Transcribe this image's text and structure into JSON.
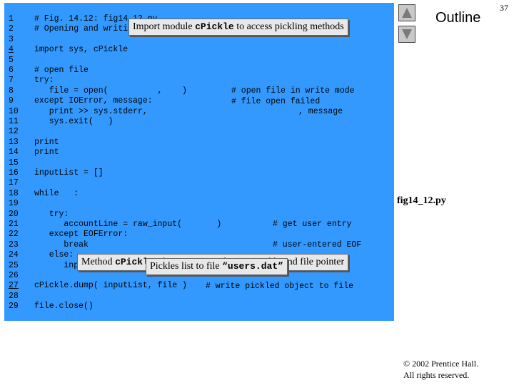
{
  "header": {
    "outline": "Outline",
    "page_number": "37"
  },
  "nav": {
    "up_icon": "triangle-up-icon",
    "down_icon": "triangle-down-icon"
  },
  "code": [
    {
      "n": "1",
      "t": "# Fig. 14.12: fig14_12.py"
    },
    {
      "n": "2",
      "t": "# Opening and writing pickled object to file."
    },
    {
      "n": "3",
      "t": ""
    },
    {
      "n": "4",
      "t": "import sys, cPickle"
    },
    {
      "n": "5",
      "t": ""
    },
    {
      "n": "6",
      "t": "# open file"
    },
    {
      "n": "7",
      "t": "try:"
    },
    {
      "n": "8",
      "t": "   file = open(          ,    )"
    },
    {
      "n": "9",
      "t": "except IOError, message:"
    },
    {
      "n": "10",
      "t": "   print >> sys.stderr,"
    },
    {
      "n": "11",
      "t": "   sys.exit(   )"
    },
    {
      "n": "12",
      "t": ""
    },
    {
      "n": "13",
      "t": "print"
    },
    {
      "n": "14",
      "t": "print"
    },
    {
      "n": "15",
      "t": ""
    },
    {
      "n": "16",
      "t": "inputList = []"
    },
    {
      "n": "17",
      "t": ""
    },
    {
      "n": "18",
      "t": "while   :"
    },
    {
      "n": "19",
      "t": ""
    },
    {
      "n": "20",
      "t": "   try:"
    },
    {
      "n": "21",
      "t": "      accountLine = raw_input(       )"
    },
    {
      "n": "22",
      "t": "   except EOFError:"
    },
    {
      "n": "23",
      "t": "      break"
    },
    {
      "n": "24",
      "t": "   else:"
    },
    {
      "n": "25",
      "t": "      inputList.append( accountLine.split() )"
    },
    {
      "n": "26",
      "t": ""
    },
    {
      "n": "27",
      "t": "cPickle.dump( inputList, file )"
    },
    {
      "n": "28",
      "t": ""
    },
    {
      "n": "29",
      "t": "file.close()"
    }
  ],
  "comments": {
    "line8": "# open file in write mode",
    "line9": "# file open failed",
    "line10": ", message",
    "line21": "# get user entry",
    "line23": "# user-entered EOF",
    "line27": "# write pickled object to file"
  },
  "callouts": {
    "import": {
      "pre": "Import module ",
      "code": "cPickle",
      "post": " to access pickling methods"
    },
    "dump": {
      "pre": "Method ",
      "code": "cPickle.dump",
      "post": " requires object to pickle and file pointer"
    },
    "pickles": {
      "pre": "Pickles list to file ",
      "code": "“users.dat”",
      "post": ""
    }
  },
  "filename": "fig14_12.py",
  "copyright": {
    "line1": "© 2002 Prentice Hall.",
    "line2": "All rights reserved."
  }
}
